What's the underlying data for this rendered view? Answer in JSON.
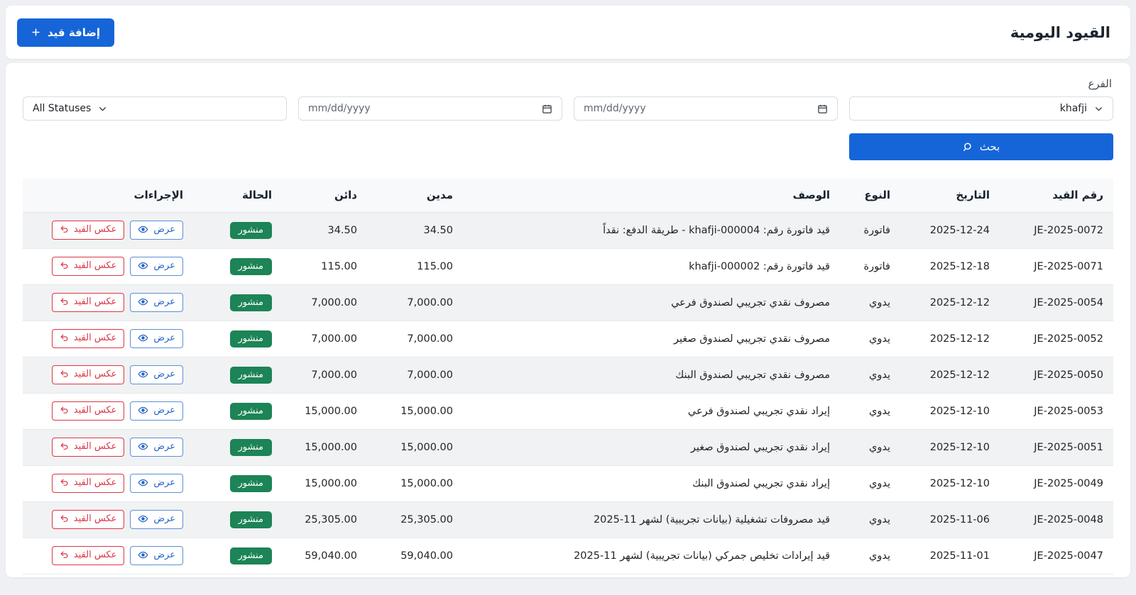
{
  "header": {
    "title": "القيود اليومية",
    "add_button": "إضافة قيد"
  },
  "filters": {
    "branch_label": "الفرع",
    "branch_selected": "khafji",
    "date_from_placeholder": "mm/dd/yyyy",
    "date_to_placeholder": "mm/dd/yyyy",
    "status_selected": "All Statuses",
    "search_button": "بحث"
  },
  "table": {
    "headers": [
      "رقم القيد",
      "التاريخ",
      "النوع",
      "الوصف",
      "مدين",
      "دائن",
      "الحالة",
      "الإجراءات"
    ],
    "actions": {
      "view": "عرض",
      "reverse": "عكس القيد"
    },
    "rows": [
      {
        "number": "JE-2025-0072",
        "date": "2025-12-24",
        "type": "فاتورة",
        "description": "قيد فاتورة رقم: khafji-000004 - طريقة الدفع: نقداً",
        "debit": "34.50",
        "credit": "34.50",
        "status": "منشور"
      },
      {
        "number": "JE-2025-0071",
        "date": "2025-12-18",
        "type": "فاتورة",
        "description": "قيد فاتورة رقم: khafji-000002",
        "debit": "115.00",
        "credit": "115.00",
        "status": "منشور"
      },
      {
        "number": "JE-2025-0054",
        "date": "2025-12-12",
        "type": "يدوي",
        "description": "مصروف نقدي تجريبي لصندوق فرعي",
        "debit": "7,000.00",
        "credit": "7,000.00",
        "status": "منشور"
      },
      {
        "number": "JE-2025-0052",
        "date": "2025-12-12",
        "type": "يدوي",
        "description": "مصروف نقدي تجريبي لصندوق صغير",
        "debit": "7,000.00",
        "credit": "7,000.00",
        "status": "منشور"
      },
      {
        "number": "JE-2025-0050",
        "date": "2025-12-12",
        "type": "يدوي",
        "description": "مصروف نقدي تجريبي لصندوق البنك",
        "debit": "7,000.00",
        "credit": "7,000.00",
        "status": "منشور"
      },
      {
        "number": "JE-2025-0053",
        "date": "2025-12-10",
        "type": "يدوي",
        "description": "إيراد نقدي تجريبي لصندوق فرعي",
        "debit": "15,000.00",
        "credit": "15,000.00",
        "status": "منشور"
      },
      {
        "number": "JE-2025-0051",
        "date": "2025-12-10",
        "type": "يدوي",
        "description": "إيراد نقدي تجريبي لصندوق صغير",
        "debit": "15,000.00",
        "credit": "15,000.00",
        "status": "منشور"
      },
      {
        "number": "JE-2025-0049",
        "date": "2025-12-10",
        "type": "يدوي",
        "description": "إيراد نقدي تجريبي لصندوق البنك",
        "debit": "15,000.00",
        "credit": "15,000.00",
        "status": "منشور"
      },
      {
        "number": "JE-2025-0048",
        "date": "2025-11-06",
        "type": "يدوي",
        "description": "قيد مصروفات تشغيلية (بيانات تجريبية) لشهر 11-2025",
        "debit": "25,305.00",
        "credit": "25,305.00",
        "status": "منشور"
      },
      {
        "number": "JE-2025-0047",
        "date": "2025-11-01",
        "type": "يدوي",
        "description": "قيد إيرادات تخليص جمركي (بيانات تجريبية) لشهر 11-2025",
        "debit": "59,040.00",
        "credit": "59,040.00",
        "status": "منشور"
      }
    ]
  },
  "colors": {
    "primary_blue": "#1565d8",
    "success_green": "#1c8456",
    "danger_red": "#dc3545",
    "stripe_gray": "#f1f2f3"
  }
}
